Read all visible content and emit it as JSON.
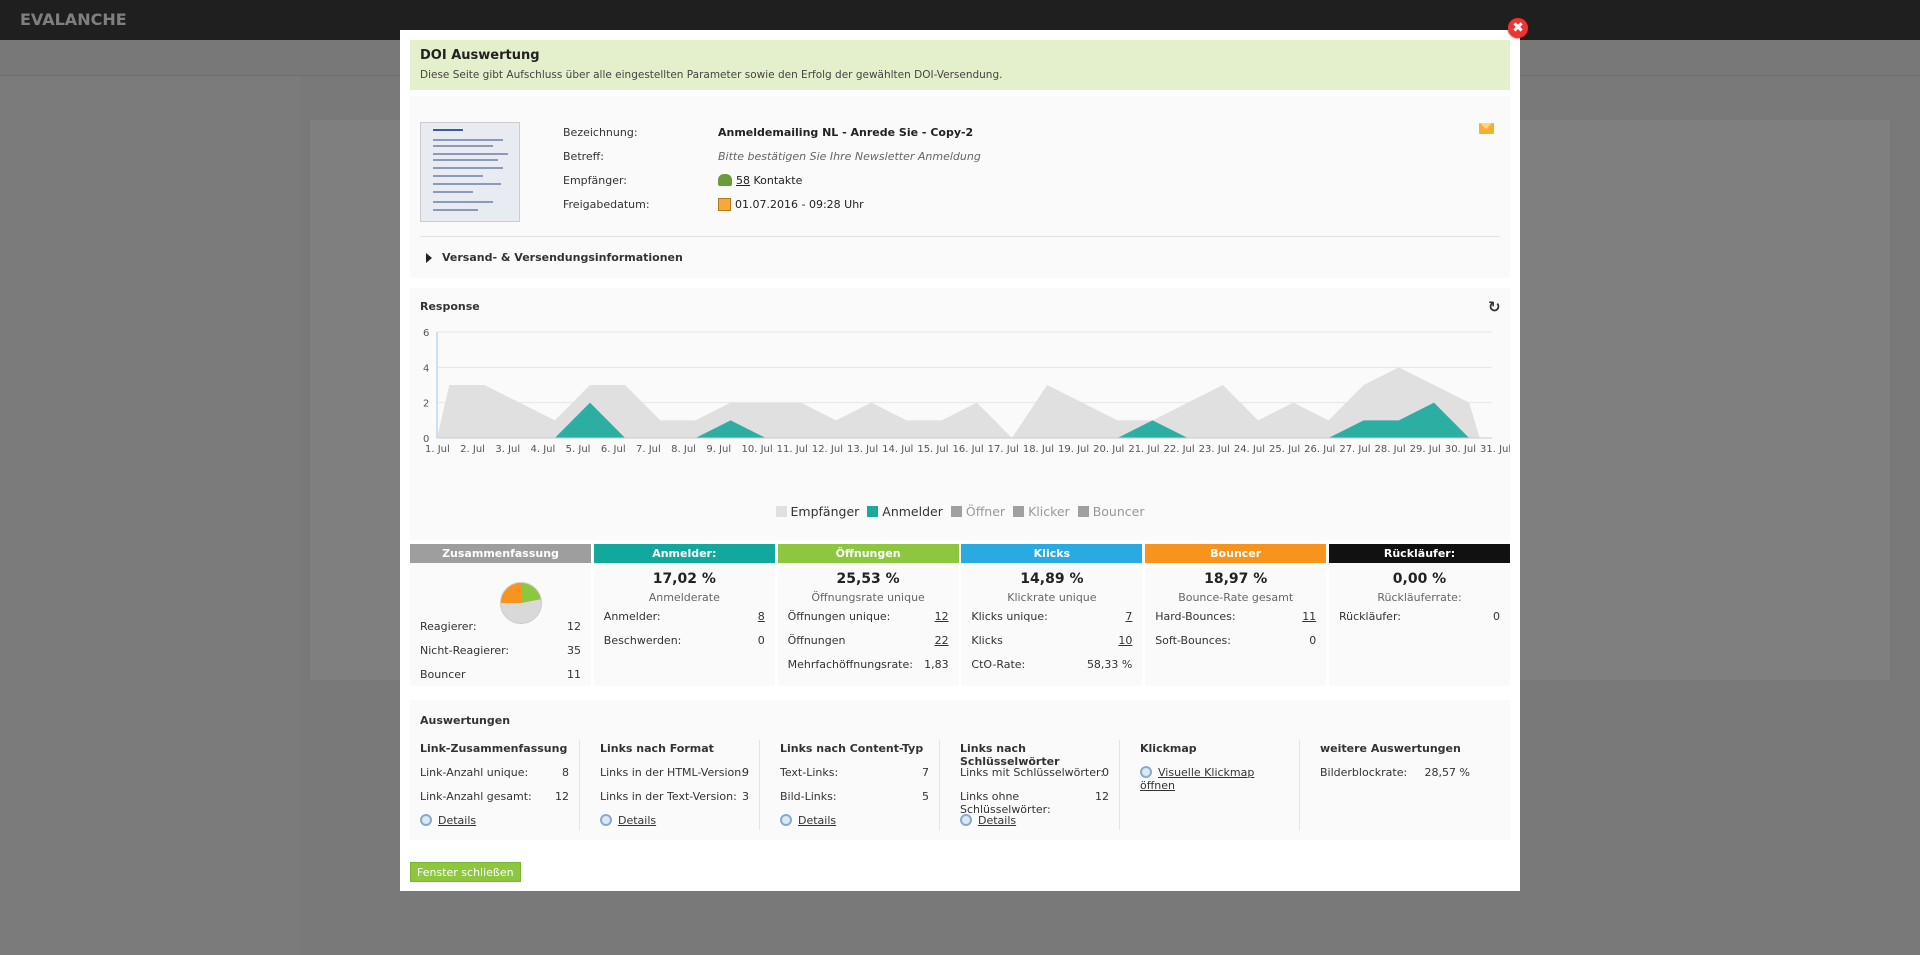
{
  "background": {
    "logo": "EVALANCHE"
  },
  "modal": {
    "title": "DOI Auswertung",
    "subtitle": "Diese Seite gibt Aufschluss über alle eingestellten Parameter sowie den Erfolg der gewählten DOI-Versendung.",
    "close_symbol": "✖",
    "info": {
      "bezeichnung_label": "Bezeichnung:",
      "bezeichnung": "Anmeldemailing NL - Anrede Sie - Copy-2",
      "betreff_label": "Betreff:",
      "betreff": "Bitte bestätigen Sie Ihre Newsletter Anmeldung",
      "empfaenger_label": "Empfänger:",
      "empfaenger_count": "58",
      "empfaenger_unit": "Kontakte",
      "freigabe_label": "Freigabedatum:",
      "freigabe": "01.07.2016 - 09:28 Uhr",
      "versand_label": "Versand- & Versendungsinformationen"
    },
    "response": {
      "title": "Response",
      "refresh_icon": "↻"
    },
    "chart_data": {
      "type": "area",
      "x": [
        "1. Jul",
        "2. Jul",
        "3. Jul",
        "4. Jul",
        "5. Jul",
        "6. Jul",
        "7. Jul",
        "8. Jul",
        "9. Jul",
        "10. Jul",
        "11. Jul",
        "12. Jul",
        "13. Jul",
        "14. Jul",
        "15. Jul",
        "16. Jul",
        "17. Jul",
        "18. Jul",
        "19. Jul",
        "20. Jul",
        "21. Jul",
        "22. Jul",
        "23. Jul",
        "24. Jul",
        "25. Jul",
        "26. Jul",
        "27. Jul",
        "28. Jul",
        "29. Jul",
        "30. Jul",
        "31. Jul"
      ],
      "ylim": [
        0,
        6
      ],
      "yticks": [
        0,
        2,
        4,
        6
      ],
      "series": [
        {
          "name": "Empfänger",
          "color": "#e0e0e0",
          "values": [
            3,
            3,
            2,
            1,
            3,
            3,
            1,
            1,
            2,
            2,
            2,
            1,
            2,
            1,
            1,
            2,
            0,
            3,
            2,
            1,
            1,
            2,
            3,
            1,
            2,
            1,
            3,
            4,
            3,
            2
          ]
        },
        {
          "name": "Anmelder",
          "color": "#1aa99b",
          "values": [
            0,
            0,
            0,
            0,
            2,
            0,
            0,
            0,
            1,
            0,
            0,
            0,
            0,
            0,
            0,
            0,
            0,
            0,
            0,
            0,
            1,
            0,
            0,
            0,
            0,
            0,
            1,
            1,
            2,
            0
          ]
        },
        {
          "name": "Öffner",
          "color": "#a0a0a0",
          "values": []
        },
        {
          "name": "Klicker",
          "color": "#a0a0a0",
          "values": []
        },
        {
          "name": "Bouncer",
          "color": "#a0a0a0",
          "values": []
        }
      ]
    },
    "stats": [
      {
        "header": "Zusammenfassung",
        "color": "#9e9e9e",
        "rows": [
          [
            "Reagierer:",
            "12"
          ],
          [
            "Nicht-Reagierer:",
            "35"
          ],
          [
            "Bouncer",
            "11"
          ]
        ]
      },
      {
        "header": "Anmelder:",
        "color": "#13a89e",
        "big": "17,02 %",
        "sub": "Anmelderate",
        "rows": [
          [
            "Anmelder:",
            "8"
          ],
          [
            "Beschwerden:",
            "0"
          ]
        ]
      },
      {
        "header": "Öffnungen",
        "color": "#8dc63f",
        "big": "25,53 %",
        "sub": "Öffnungsrate unique",
        "rows": [
          [
            "Öffnungen unique:",
            "12"
          ],
          [
            "Öffnungen",
            "22"
          ],
          [
            "Mehrfachöffnungsrate:",
            "1,83"
          ]
        ]
      },
      {
        "header": "Klicks",
        "color": "#29abe2",
        "big": "14,89 %",
        "sub": "Klickrate unique",
        "rows": [
          [
            "Klicks unique:",
            "7"
          ],
          [
            "Klicks",
            "10"
          ],
          [
            "CtO-Rate:",
            "58,33 %"
          ]
        ]
      },
      {
        "header": "Bouncer",
        "color": "#f7941d",
        "big": "18,97 %",
        "sub": "Bounce-Rate gesamt",
        "rows": [
          [
            "Hard-Bounces:",
            "11"
          ],
          [
            "Soft-Bounces:",
            "0"
          ]
        ]
      },
      {
        "header": "Rückläufer:",
        "color": "#111111",
        "big": "0,00 %",
        "sub": "Rückläuferrate:",
        "rows": [
          [
            "Rückläufer:",
            "0"
          ]
        ]
      }
    ],
    "auswertungen": {
      "title": "Auswertungen",
      "cols": [
        {
          "header": "Link-Zusammenfassung",
          "rows": [
            [
              "Link-Anzahl unique:",
              "8"
            ],
            [
              "Link-Anzahl gesamt:",
              "12"
            ]
          ],
          "link": "Details"
        },
        {
          "header": "Links nach Format",
          "rows": [
            [
              "Links in der HTML-Version:",
              "9"
            ],
            [
              "Links in der Text-Version:",
              "3"
            ]
          ],
          "link": "Details"
        },
        {
          "header": "Links nach Content-Typ",
          "rows": [
            [
              "Text-Links:",
              "7"
            ],
            [
              "Bild-Links:",
              "5"
            ]
          ],
          "link": "Details"
        },
        {
          "header": "Links nach Schlüsselwörter",
          "rows": [
            [
              "Links mit Schlüsselwörter:",
              "0"
            ],
            [
              "Links ohne Schlüsselwörter:",
              "12"
            ]
          ],
          "link": "Details"
        },
        {
          "header": "Klickmap",
          "rows": [],
          "link": "Visuelle Klickmap öffnen"
        },
        {
          "header": "weitere Auswertungen",
          "rows": [
            [
              "Bilderblockrate:",
              "28,57 %"
            ]
          ],
          "link": ""
        }
      ]
    },
    "close_button": "Fenster schließen"
  }
}
